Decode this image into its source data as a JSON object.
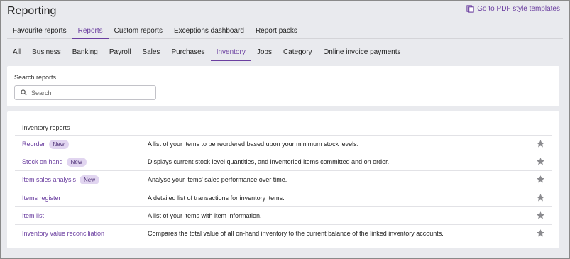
{
  "page": {
    "title": "Reporting"
  },
  "pdf_link": {
    "label": "Go to PDF style templates",
    "icon": "template-icon"
  },
  "main_tabs": [
    {
      "label": "Favourite reports",
      "active": false
    },
    {
      "label": "Reports",
      "active": true
    },
    {
      "label": "Custom reports",
      "active": false
    },
    {
      "label": "Exceptions dashboard",
      "active": false
    },
    {
      "label": "Report packs",
      "active": false
    }
  ],
  "sub_tabs": [
    {
      "label": "All",
      "active": false
    },
    {
      "label": "Business",
      "active": false
    },
    {
      "label": "Banking",
      "active": false
    },
    {
      "label": "Payroll",
      "active": false
    },
    {
      "label": "Sales",
      "active": false
    },
    {
      "label": "Purchases",
      "active": false
    },
    {
      "label": "Inventory",
      "active": true
    },
    {
      "label": "Jobs",
      "active": false
    },
    {
      "label": "Category",
      "active": false
    },
    {
      "label": "Online invoice payments",
      "active": false
    }
  ],
  "search": {
    "label": "Search reports",
    "placeholder": "Search",
    "value": ""
  },
  "inventory": {
    "title": "Inventory reports",
    "reports": [
      {
        "name": "Reorder",
        "badge": "New",
        "description": "A list of your items to be reordered based upon your minimum stock levels."
      },
      {
        "name": "Stock on hand",
        "badge": "New",
        "description": "Displays current stock level quantities, and inventoried items committed and on order."
      },
      {
        "name": "Item sales analysis",
        "badge": "New",
        "description": "Analyse your items' sales performance over time."
      },
      {
        "name": "Items register",
        "badge": "",
        "description": "A detailed list of transactions for inventory items."
      },
      {
        "name": "Item list",
        "badge": "",
        "description": "A list of your items with item information."
      },
      {
        "name": "Inventory value reconciliation",
        "badge": "",
        "description": "Compares the total value of all on-hand inventory to the current balance of the linked inventory accounts."
      }
    ]
  },
  "colors": {
    "accent": "#6b3fa0",
    "badge_bg": "#e1d5f0",
    "background": "#e9eaee"
  }
}
